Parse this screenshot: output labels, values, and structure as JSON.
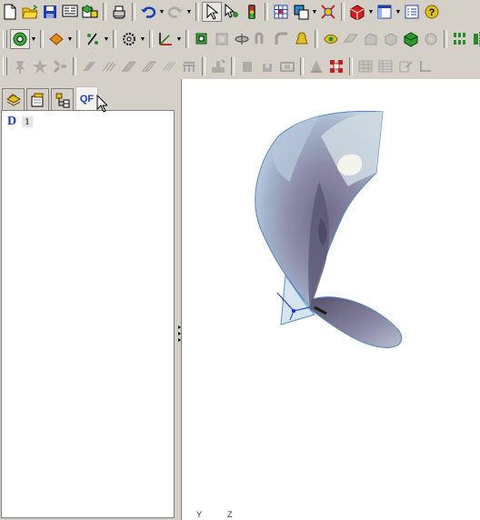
{
  "toolbars": {
    "row1": [
      "new-document-icon",
      "open-folder-icon",
      "save-icon",
      "toolbar-manager-icon",
      "part-manager-icon",
      "print-icon",
      "undo-icon",
      "redo-icon",
      "select-arrow-icon",
      "select-filter-icon",
      "traffic-light-icon",
      "grid-icon",
      "rotate-view-icon",
      "display-icon",
      "render-icon",
      "window-icon",
      "properties-icon",
      "help-icon"
    ],
    "row2": [
      "curve-tool-icon",
      "feature-diamond-icon",
      "percent-tool-icon",
      "gear-tool-icon",
      "axis-tool-icon",
      "extrude-icon",
      "shell-icon",
      "revolve-icon",
      "pipe-icon",
      "fillet-icon",
      "bell-icon",
      "surface-icon",
      "offset-icon",
      "blend-icon",
      "box-icon",
      "green-solid-icon",
      "hole-icon",
      "pattern-icon",
      "mirror-icon"
    ],
    "row3": [
      "pin-icon",
      "star-tool-icon",
      "gear-grey-icon",
      "slab-icon",
      "hatch-icon",
      "sheet-icon",
      "sheet-hatch-icon",
      "hatch-double-icon",
      "table-icon",
      "stamp-icon",
      "block-icon",
      "bracket-icon",
      "frame-icon",
      "pyramid-icon",
      "pattern-red-icon",
      "grid-table-icon",
      "spreadsheet-icon",
      "document-edit-icon",
      "corner-icon"
    ]
  },
  "panel": {
    "tabs": [
      {
        "name": "features",
        "icon": "layers-icon",
        "label": ""
      },
      {
        "name": "properties",
        "icon": "tag-icon",
        "label": ""
      },
      {
        "name": "hierarchy",
        "icon": "hierarchy-icon",
        "label": ""
      },
      {
        "name": "qf",
        "icon": "",
        "label": "QF"
      }
    ],
    "active_tab": "qf",
    "tree": {
      "root_label": "D",
      "item_label": "1"
    }
  },
  "viewport": {
    "axis_labels": {
      "y": "Y",
      "z": "Z"
    }
  },
  "colors": {
    "chrome": "#d4d0c8",
    "accent": "#1a3fb8"
  }
}
